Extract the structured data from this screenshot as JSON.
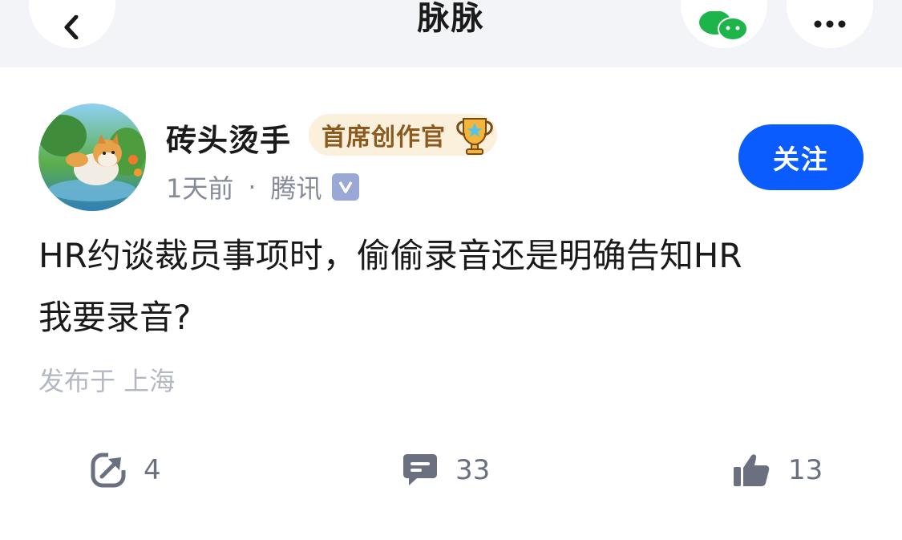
{
  "header": {
    "title": "脉脉",
    "back_icon": "chevron-left-icon",
    "share_icon": "wechat-icon",
    "more_icon": "more-horizontal-icon"
  },
  "post": {
    "author": {
      "name": "砖头烫手",
      "badge": "首席创作官",
      "time": "1天前",
      "company": "腾讯",
      "verified_icon": "verified-icon"
    },
    "follow_label": "关注",
    "content_line1": "HR约谈裁员事项时，偷偷录音还是明确告知HR",
    "content_line2": "我要录音?",
    "location": "发布于 上海",
    "actions": {
      "share_count": "4",
      "comment_count": "33",
      "like_count": "13"
    }
  },
  "colors": {
    "accent": "#0b5cff",
    "topbar_bg": "#f3f4f8",
    "badge_bg": "#fbf0dc",
    "badge_text": "#8a5a1f"
  }
}
